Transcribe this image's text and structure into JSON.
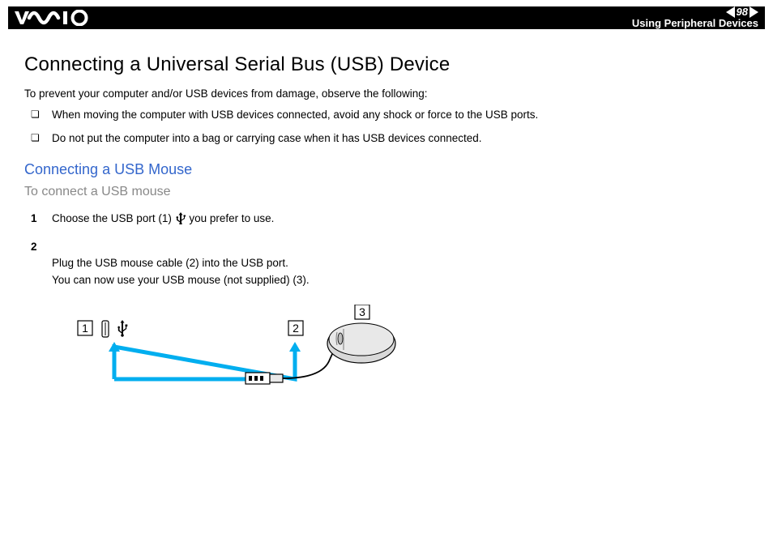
{
  "header": {
    "page_number": "98",
    "section_title": "Using Peripheral Devices"
  },
  "main": {
    "title": "Connecting a Universal Serial Bus (USB) Device",
    "intro": "To prevent your computer and/or USB devices from damage, observe the following:",
    "precautions": [
      "When moving the computer with USB devices connected, avoid any shock or force to the USB ports.",
      "Do not put the computer into a bag or carrying case when it has USB devices connected."
    ],
    "subsection_title": "Connecting a USB Mouse",
    "task_title": "To connect a USB mouse",
    "steps": [
      {
        "pre": "Choose the USB port (1) ",
        "post": " you prefer to use."
      },
      {
        "pre": "Plug the USB mouse cable (2) into the USB port.\nYou can now use your USB mouse (not supplied) (3).",
        "post": ""
      }
    ],
    "diagram_labels": {
      "l1": "1",
      "l2": "2",
      "l3": "3"
    }
  }
}
